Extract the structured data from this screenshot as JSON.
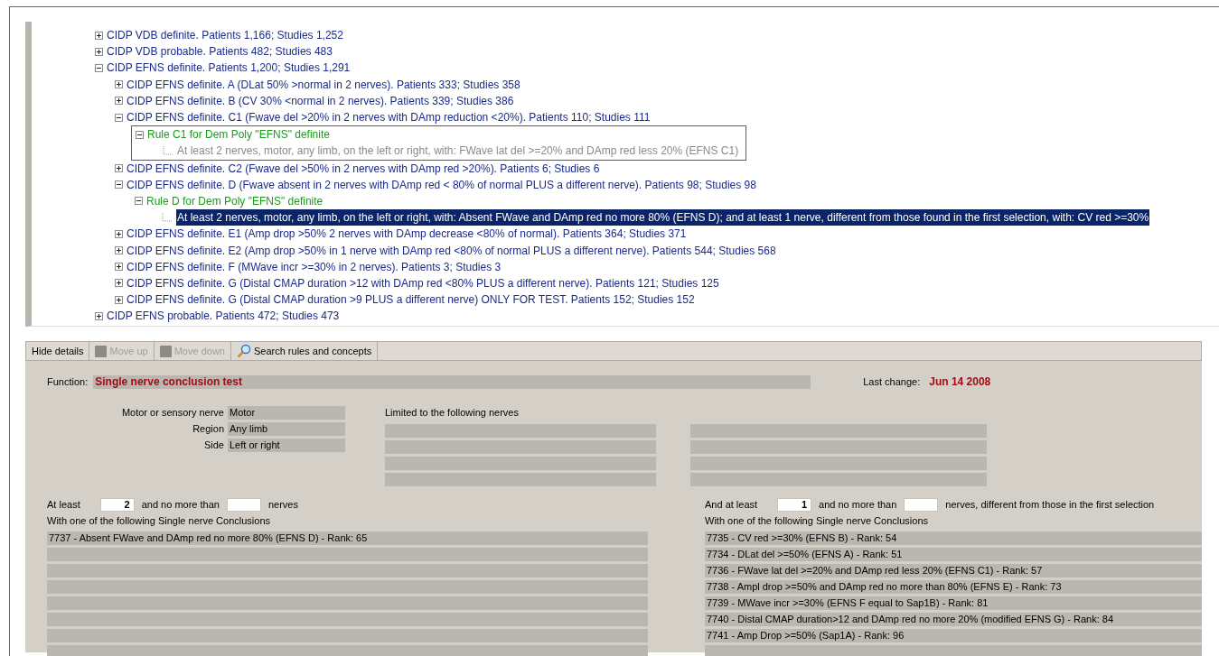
{
  "tree": [
    {
      "text": "CIDP VDB definite. Patients 1,166; Studies 1,252",
      "kind": "category",
      "expanded": false,
      "selected": false
    },
    {
      "text": "CIDP VDB probable. Patients 482; Studies 483",
      "kind": "category",
      "expanded": false,
      "selected": false
    },
    {
      "text": "CIDP EFNS definite. Patients 1,200; Studies 1,291",
      "kind": "category",
      "expanded": true,
      "selected": false,
      "children": [
        {
          "text": "CIDP EFNS definite. A (DLat 50% >normal in 2 nerves). Patients 333; Studies 358",
          "kind": "category",
          "expanded": false,
          "selected": false
        },
        {
          "text": "CIDP EFNS definite. B (CV 30% <normal in 2 nerves). Patients 339; Studies 386",
          "kind": "category",
          "expanded": false,
          "selected": false
        },
        {
          "text": "CIDP EFNS definite. C1 (Fwave del >20% in 2 nerves with DAmp reduction <20%). Patients 110; Studies 111",
          "kind": "category",
          "expanded": true,
          "selected": false,
          "children": [
            {
              "text": "Rule C1 for Dem Poly \"EFNS\" definite",
              "kind": "rule",
              "expanded": true,
              "selected": false,
              "outlined": true,
              "children": [
                {
                  "text": "At least 2 nerves, motor, any limb, on the left or right, with: FWave lat del >=20% and DAmp red less 20% (EFNS C1)",
                  "kind": "criterion",
                  "selected": false
                }
              ]
            }
          ]
        },
        {
          "text": "CIDP EFNS definite. C2 (Fwave del >50% in 2 nerves with DAmp red >20%). Patients 6; Studies 6",
          "kind": "category",
          "expanded": false,
          "selected": false
        },
        {
          "text": "CIDP EFNS definite. D (Fwave absent in 2 nerves with DAmp red < 80% of normal PLUS a different nerve). Patients 98; Studies 98",
          "kind": "category",
          "expanded": true,
          "selected": false,
          "children": [
            {
              "text": "Rule D for Dem Poly \"EFNS\" definite",
              "kind": "rule",
              "expanded": true,
              "selected": false,
              "outlined": false,
              "children": [
                {
                  "text": "At least 2 nerves, motor, any limb, on the left or right, with: Absent FWave and DAmp red no more 80% (EFNS D); and at least 1 nerve, different from those found in the first selection, with: CV red >=30%",
                  "kind": "criterion",
                  "selected": true
                }
              ]
            }
          ]
        },
        {
          "text": "CIDP EFNS definite. E1 (Amp drop >50% 2 nerves with DAmp decrease <80% of normal). Patients 364; Studies 371",
          "kind": "category",
          "expanded": false,
          "selected": false
        },
        {
          "text": "CIDP EFNS definite. E2 (Amp drop >50% in 1 nerve with DAmp red <80% of normal PLUS a different nerve). Patients 544; Studies 568",
          "kind": "category",
          "expanded": false,
          "selected": false
        },
        {
          "text": "CIDP EFNS definite. F (MWave incr >=30% in 2 nerves). Patients 3; Studies 3",
          "kind": "category",
          "expanded": false,
          "selected": false
        },
        {
          "text": "CIDP EFNS definite. G (Distal CMAP duration >12 with DAmp red <80% PLUS a different nerve). Patients 121; Studies 125",
          "kind": "category",
          "expanded": false,
          "selected": false
        },
        {
          "text": "CIDP EFNS definite. G (Distal CMAP duration >9 PLUS a different nerve) ONLY FOR TEST. Patients 152; Studies 152",
          "kind": "category",
          "expanded": false,
          "selected": false
        }
      ]
    },
    {
      "text": "CIDP EFNS probable. Patients 472; Studies 473",
      "kind": "category",
      "expanded": false,
      "selected": false
    }
  ],
  "toolbar": [
    {
      "label": "Hide details",
      "kind": "plain",
      "disabled": false
    },
    {
      "label": "Move up",
      "kind": "block",
      "disabled": true
    },
    {
      "label": "Move down",
      "kind": "block",
      "disabled": true
    },
    {
      "label": "Search rules and concepts",
      "kind": "search",
      "disabled": false
    }
  ],
  "details": {
    "function_label": "Function:",
    "function_value": "Single nerve conclusion test",
    "last_change_label": "Last change:",
    "last_change_value": "Jun 14 2008",
    "properties": [
      {
        "label": "Motor or sensory nerve",
        "value": "Motor"
      },
      {
        "label": "Region",
        "value": "Any limb"
      },
      {
        "label": "Side",
        "value": "Left or right"
      }
    ],
    "nerves_label": "Limited to the following nerves"
  },
  "first_selection": {
    "at_least_label": "At least",
    "at_least": "2",
    "no_more_label": "and no more than",
    "suffix": "nerves",
    "list_label": "With one of the following Single nerve Conclusions",
    "conclusions": [
      "7737 - Absent FWave and DAmp red no more 80% (EFNS D) - Rank: 65"
    ]
  },
  "second_selection": {
    "at_least_label": "And at least",
    "at_least": "1",
    "no_more_label": "and no more than",
    "suffix": "nerves, different from those in the first selection",
    "list_label": "With one of the following Single nerve Conclusions",
    "conclusions": [
      "7735 - CV red >=30% (EFNS B) - Rank: 54",
      "7734 - DLat del >=50% (EFNS A) - Rank: 51",
      "7736 - FWave lat del >=20% and DAmp red less 20% (EFNS C1) - Rank: 57",
      "7738 - Ampl drop >=50% and DAmp red no more than 80% (EFNS E) - Rank: 73",
      "7739 - MWave incr >=30% (EFNS F equal to Sap1B) - Rank: 81",
      "7740 - Distal CMAP duration>12 and DAmp red no more 20% (modified EFNS G) - Rank: 84",
      "7741 - Amp Drop >=50% (Sap1A) - Rank: 96"
    ]
  }
}
